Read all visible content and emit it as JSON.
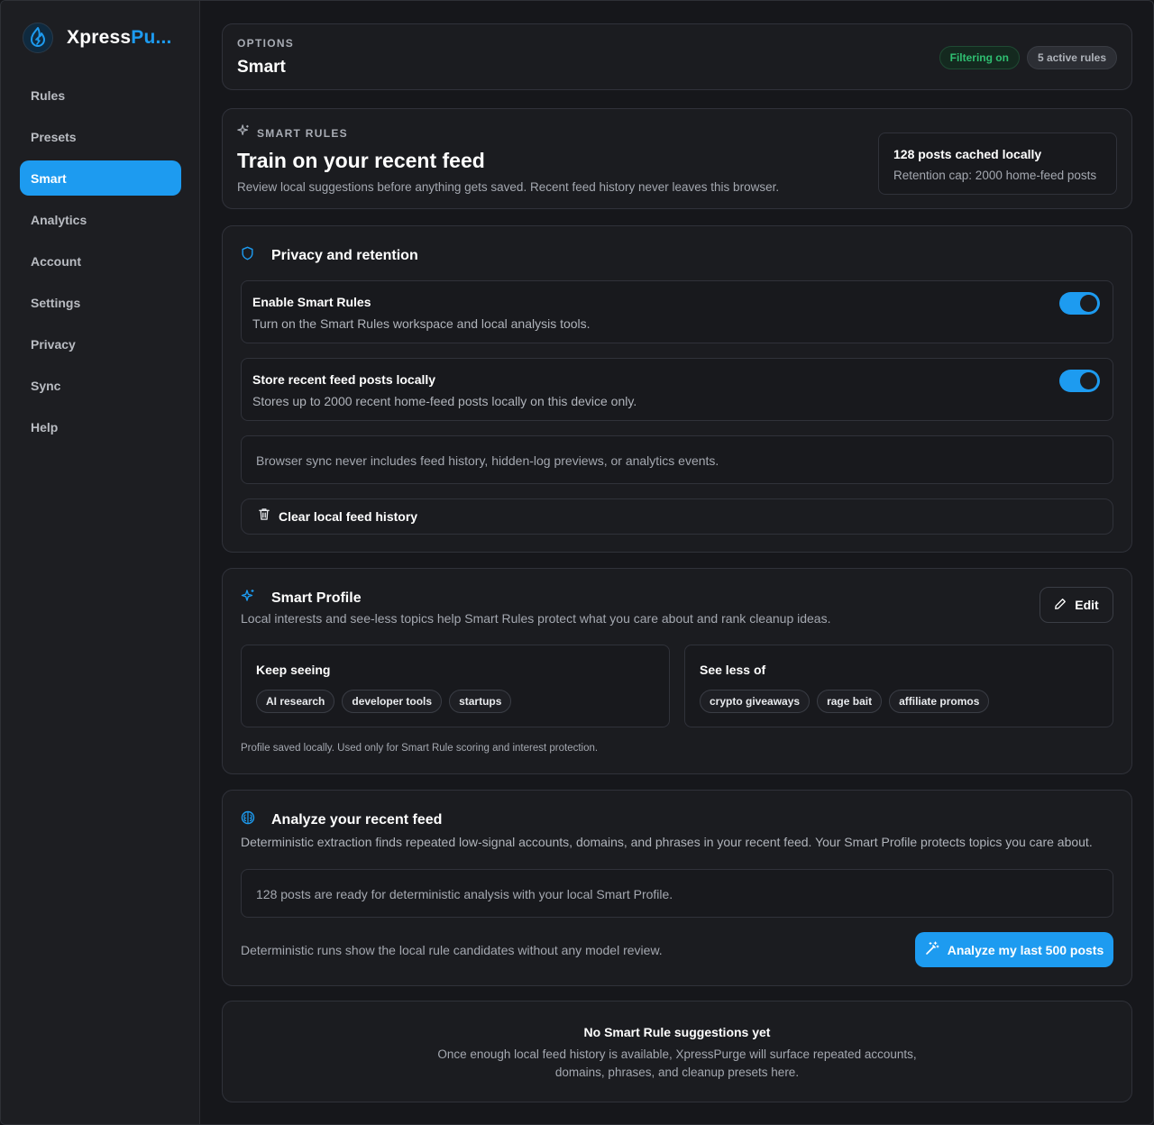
{
  "brand": {
    "name_main": "Xpress",
    "name_accent": "Pu..."
  },
  "colors": {
    "accent": "#1d9bf0",
    "success": "#2fbf71",
    "background": "#16171b",
    "card": "#1b1c20"
  },
  "sidebar": {
    "items": [
      {
        "label": "Rules",
        "active": false
      },
      {
        "label": "Presets",
        "active": false
      },
      {
        "label": "Smart",
        "active": true
      },
      {
        "label": "Analytics",
        "active": false
      },
      {
        "label": "Account",
        "active": false
      },
      {
        "label": "Settings",
        "active": false
      },
      {
        "label": "Privacy",
        "active": false
      },
      {
        "label": "Sync",
        "active": false
      },
      {
        "label": "Help",
        "active": false
      }
    ]
  },
  "header": {
    "eyebrow": "OPTIONS",
    "title": "Smart",
    "status_badge": "Filtering on",
    "rules_badge": "5 active rules"
  },
  "intro": {
    "eyebrow": "SMART RULES",
    "title": "Train on your recent feed",
    "description": "Review local suggestions before anything gets saved. Recent feed history never leaves this browser.",
    "cache_title": "128 posts cached locally",
    "cache_subtitle": "Retention cap: 2000 home-feed posts"
  },
  "privacy": {
    "title": "Privacy and retention",
    "enable": {
      "title": "Enable Smart Rules",
      "description": "Turn on the Smart Rules workspace and local analysis tools.",
      "checked": true
    },
    "store": {
      "title": "Store recent feed posts locally",
      "description": "Stores up to 2000 recent home-feed posts locally on this device only.",
      "checked": true
    },
    "note": "Browser sync never includes feed history, hidden-log previews, or analytics events.",
    "clear_button": "Clear local feed history"
  },
  "profile": {
    "title": "Smart Profile",
    "description": "Local interests and see-less topics help Smart Rules protect what you care about and rank cleanup ideas.",
    "edit_button": "Edit",
    "keep": {
      "title": "Keep seeing",
      "tags": [
        "AI research",
        "developer tools",
        "startups"
      ]
    },
    "less": {
      "title": "See less of",
      "tags": [
        "crypto giveaways",
        "rage bait",
        "affiliate promos"
      ]
    },
    "footnote": "Profile saved locally. Used only for Smart Rule scoring and interest protection."
  },
  "analyze": {
    "title": "Analyze your recent feed",
    "description": "Deterministic extraction finds repeated low-signal accounts, domains, and phrases in your recent feed. Your Smart Profile protects topics you care about.",
    "status": "128 posts are ready for deterministic analysis with your local Smart Profile.",
    "footnote": "Deterministic runs show the local rule candidates without any model review.",
    "button": "Analyze my last 500 posts"
  },
  "empty": {
    "title": "No Smart Rule suggestions yet",
    "line1": "Once enough local feed history is available, XpressPurge will surface repeated accounts,",
    "line2": "domains, phrases, and cleanup presets here."
  }
}
